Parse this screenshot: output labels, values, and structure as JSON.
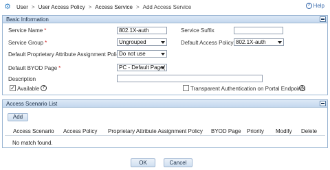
{
  "breadcrumb": {
    "items": [
      "User",
      "User Access Policy",
      "Access Service",
      "Add Access Service"
    ],
    "separator": ">"
  },
  "help": {
    "label": "Help"
  },
  "basic": {
    "title": "Basic Information",
    "service_name": {
      "label": "Service Name",
      "value": "802.1X-auth"
    },
    "service_suffix": {
      "label": "Service Suffix",
      "value": ""
    },
    "service_group": {
      "label": "Service Group",
      "value": "Ungrouped"
    },
    "default_access_policy": {
      "label": "Default Access Policy",
      "value": "802.1X-auth"
    },
    "proprietary_policy": {
      "label": "Default Proprietary Attribute Assignment Policy",
      "value": "Do not use"
    },
    "byod_page": {
      "label": "Default BYOD Page",
      "value": "PC - Default Page("
    },
    "description": {
      "label": "Description",
      "value": ""
    },
    "available": {
      "label": "Available",
      "checked": true,
      "mark": "✓"
    },
    "transparent_auth": {
      "label": "Transparent Authentication on Portal Endpoints",
      "checked": false
    }
  },
  "scenario": {
    "title": "Access Scenario List",
    "add_label": "Add",
    "columns": [
      "Access Scenario",
      "Access Policy",
      "Proprietary Attribute Assignment Policy",
      "BYOD Page",
      "Priority",
      "Modify",
      "Delete"
    ],
    "empty_text": "No match found."
  },
  "required_mark": "*",
  "help_glyph": "?",
  "actions": {
    "ok_label": "OK",
    "cancel_label": "Cancel"
  },
  "colors": {
    "accent": "#3a86c8",
    "panel_header": "#c5d8ee",
    "required": "#d02020"
  }
}
